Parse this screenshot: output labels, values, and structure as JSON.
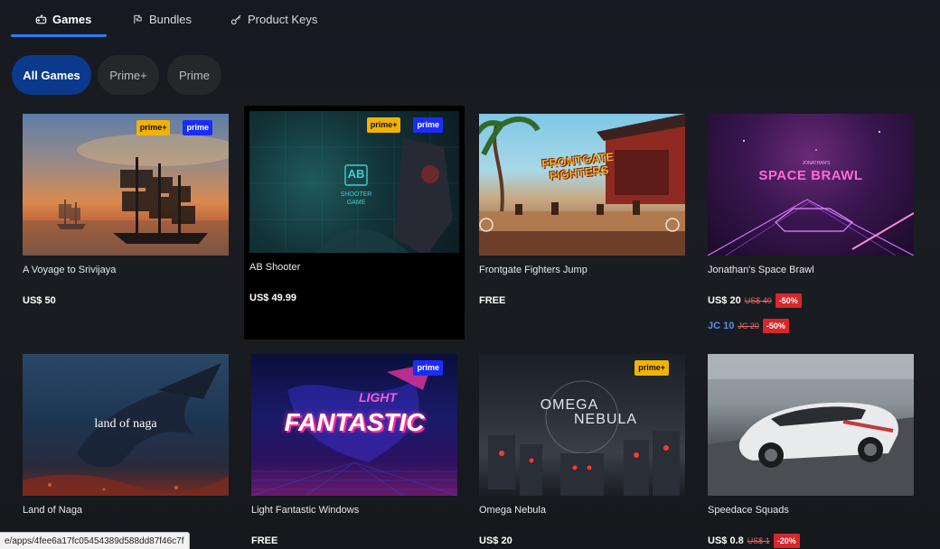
{
  "tabs": [
    {
      "label": "Games",
      "icon": "gamepad-icon",
      "active": true
    },
    {
      "label": "Bundles",
      "icon": "flag-icon",
      "active": false
    },
    {
      "label": "Product Keys",
      "icon": "key-icon",
      "active": false
    }
  ],
  "filters": [
    {
      "label": "All Games",
      "active": true
    },
    {
      "label": "Prime+",
      "active": false
    },
    {
      "label": "Prime",
      "active": false
    }
  ],
  "badges": {
    "prime_plus": "prime+",
    "prime": "prime"
  },
  "games": [
    {
      "title": "A Voyage to Srivijaya",
      "price": "US$ 50",
      "badges": [
        "prime+",
        "prime"
      ],
      "art": "ship-sunset"
    },
    {
      "title": "AB Shooter",
      "price": "US$ 49.99",
      "badges": [
        "prime+",
        "prime"
      ],
      "art": "ab-shooter",
      "logo_text": "SHOOTER\nGAME",
      "logo_mark": "AB"
    },
    {
      "title": "Frontgate Fighters Jump",
      "price": "FREE",
      "badges": [],
      "art": "fighters",
      "logo_text": "FRONTGATE FIGHTERS"
    },
    {
      "title": "Jonathan's Space Brawl",
      "price": "US$ 20",
      "old_price": "US$ 40",
      "discount": "-50%",
      "alt_price": "JC 10",
      "alt_old_price": "JC 20",
      "alt_discount": "-50%",
      "badges": [],
      "art": "space-brawl",
      "logo_text": "SPACE BRAWL",
      "logo_small": "JONATHAN'S"
    },
    {
      "title": "Land of Naga",
      "price": "",
      "badges": [],
      "art": "naga",
      "logo_text": "land of naga"
    },
    {
      "title": "Light Fantastic Windows",
      "price": "FREE",
      "badges": [
        "prime"
      ],
      "art": "light-fantastic",
      "logo_text": "LIGHT",
      "logo_text2": "FANTASTIC"
    },
    {
      "title": "Omega Nebula",
      "price": "US$ 20",
      "badges": [
        "prime+"
      ],
      "art": "omega",
      "logo_text": "OMEGA",
      "logo_text2": "NEBULA"
    },
    {
      "title": "Speedace Squads",
      "price": "US$ 0.8",
      "old_price": "US$ 1",
      "discount": "-20%",
      "badges": [],
      "art": "car"
    }
  ],
  "status_url": "e/apps/4fee6a17fc05454389d588dd87f46c7f",
  "colors": {
    "accent": "#2f7cf6",
    "active_pill": "#0b3a8c",
    "discount": "#d9262b",
    "prime_plus": "#f1b300",
    "prime": "#1a2cff"
  }
}
